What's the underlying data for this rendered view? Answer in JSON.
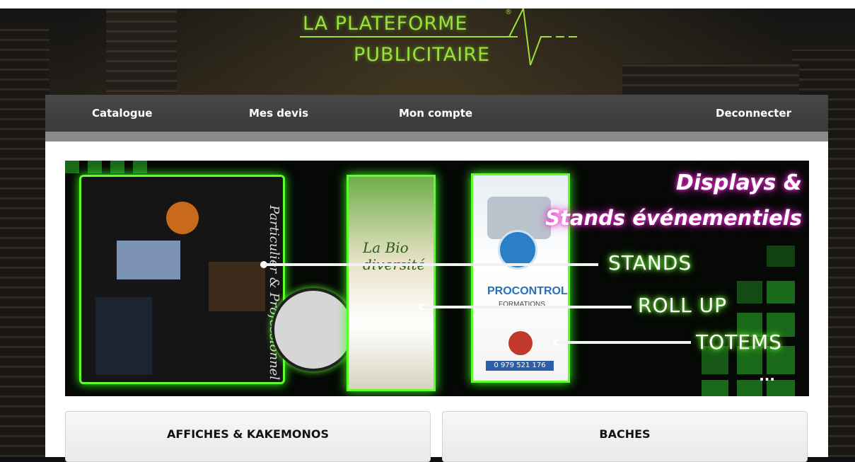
{
  "logo": {
    "line1": "LA PLATEFORME",
    "line2": "PUBLICITAIRE",
    "registered": "®",
    "color": "#9be03a"
  },
  "nav": {
    "items": [
      {
        "label": "Catalogue"
      },
      {
        "label": "Mes devis"
      },
      {
        "label": "Mon compte"
      },
      {
        "label": "Deconnecter"
      }
    ]
  },
  "banner": {
    "title_line1": "Displays &",
    "title_line2": "Stands événementiels",
    "labels": [
      "STANDS",
      "ROLL UP",
      "TOTEMS"
    ],
    "ellipsis": "...",
    "stand_text": "Particulier & Professionnel",
    "rollup_text": "La Bio diversité",
    "totem_text": "PROCONTROL",
    "totem_subtext": "FORMATIONS",
    "totem_phone": "0 979 521 176",
    "accent_green": "#5cff2a",
    "accent_pink": "#ff33dd"
  },
  "categories": [
    {
      "label": "AFFICHES & KAKEMONOS"
    },
    {
      "label": "BACHES"
    }
  ]
}
